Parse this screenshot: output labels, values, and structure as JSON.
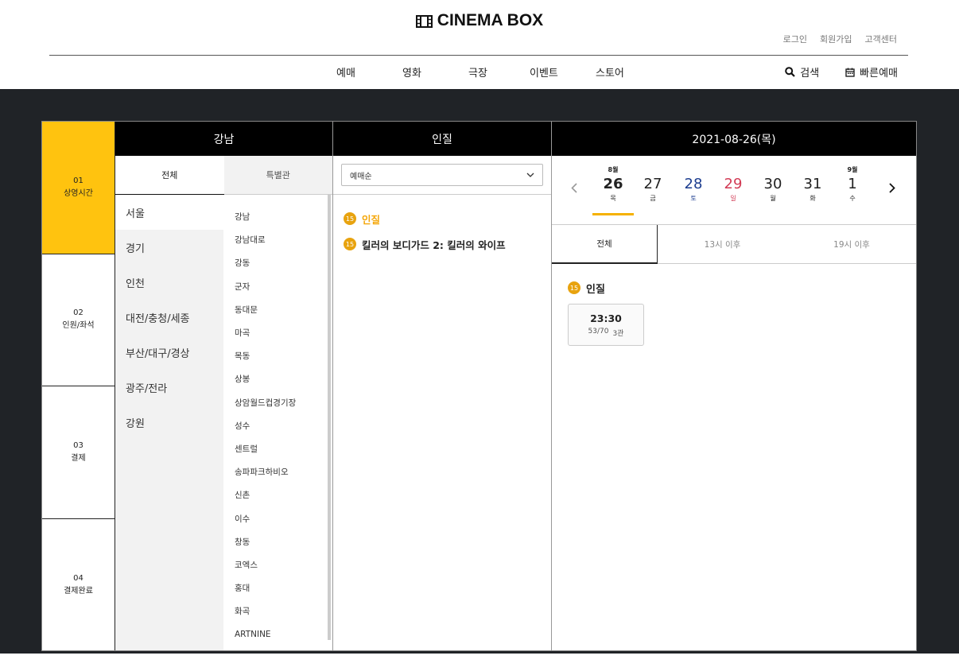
{
  "header": {
    "logo": "CINEMA BOX",
    "util_links": [
      "로그인",
      "회원가입",
      "고객센터"
    ],
    "nav": [
      "예매",
      "영화",
      "극장",
      "이벤트",
      "스토어"
    ],
    "search_label": "검색",
    "quick_booking_label": "빠른예매"
  },
  "steps": [
    {
      "num": "01",
      "label": "상영시간"
    },
    {
      "num": "02",
      "label": "인원/좌석"
    },
    {
      "num": "03",
      "label": "결제"
    },
    {
      "num": "04",
      "label": "결제완료"
    }
  ],
  "theater": {
    "header": "강남",
    "tabs": [
      "전체",
      "특별관"
    ],
    "regions": [
      "서울",
      "경기",
      "인천",
      "대전/충청/세종",
      "부산/대구/경상",
      "광주/전라",
      "강원"
    ],
    "branches": [
      "강남",
      "강남대로",
      "강동",
      "군자",
      "동대문",
      "마곡",
      "목동",
      "상봉",
      "상암월드컵경기장",
      "성수",
      "센트럴",
      "송파파크하비오",
      "신촌",
      "이수",
      "창동",
      "코엑스",
      "홍대",
      "화곡",
      "ARTNINE"
    ]
  },
  "movie": {
    "header": "인질",
    "sort": "예매순",
    "list": [
      {
        "age": "15",
        "title": "인질"
      },
      {
        "age": "15",
        "title": "킬러의 보디가드 2: 킬러의 와이프"
      }
    ]
  },
  "date": {
    "header": "2021-08-26(목)",
    "days": [
      {
        "month": "8월",
        "num": "26",
        "dow": "목"
      },
      {
        "month": "",
        "num": "27",
        "dow": "금"
      },
      {
        "month": "",
        "num": "28",
        "dow": "토"
      },
      {
        "month": "",
        "num": "29",
        "dow": "일"
      },
      {
        "month": "",
        "num": "30",
        "dow": "월"
      },
      {
        "month": "",
        "num": "31",
        "dow": "화"
      },
      {
        "month": "9월",
        "num": "1",
        "dow": "수"
      }
    ],
    "time_tabs": [
      "전체",
      "13시 이후",
      "19시 이후"
    ],
    "schedule": {
      "age": "15",
      "title": "인질",
      "showtime": {
        "time": "23:30",
        "seats": "53/70",
        "hall": "3관"
      }
    }
  },
  "colors": {
    "accent": "#ffc30f",
    "dark_bg": "#202327",
    "saturday": "#1c3d8f",
    "sunday": "#d23b55",
    "age_badge": "#e8a30f"
  }
}
